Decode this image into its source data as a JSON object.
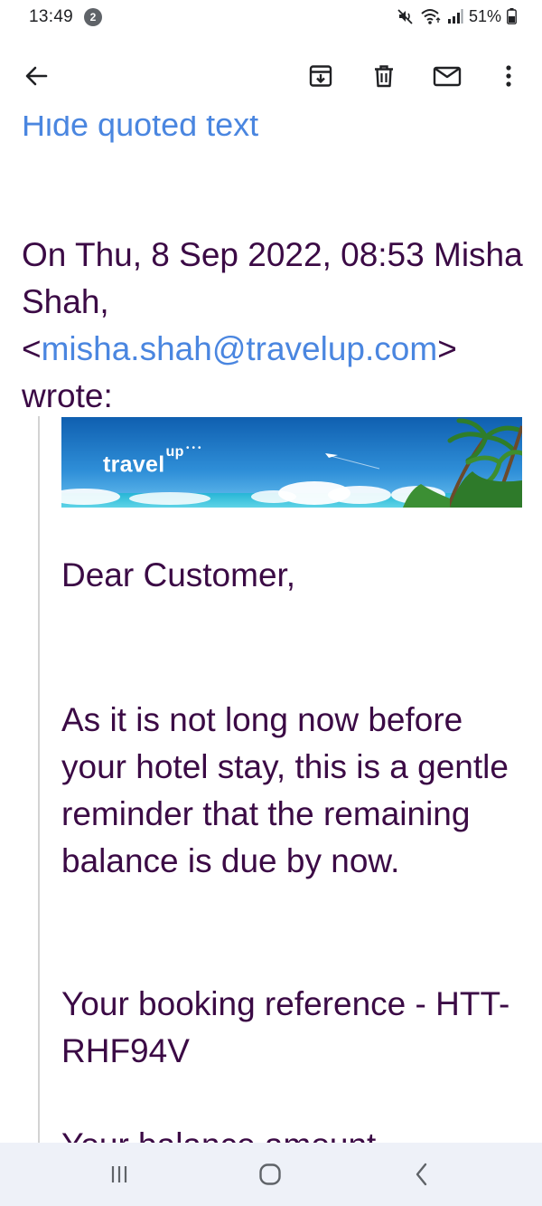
{
  "status_bar": {
    "time": "13:49",
    "notification_count": "2",
    "battery": "51%"
  },
  "toolbar": {
    "icons": [
      "back-arrow-icon",
      "archive-icon",
      "delete-icon",
      "mark-unread-icon",
      "more-vert-icon"
    ]
  },
  "email": {
    "hide_quoted_text": "Hide quoted text",
    "quote_header_prefix": "On Thu, 8 Sep 2022, 08:53 Misha Shah, <",
    "sender_email": "misha.shah@travelup.com",
    "quote_header_suffix": "> wrote:",
    "banner_logo": "travel",
    "banner_logo_sup": "up",
    "greeting": "Dear Customer,",
    "body_paragraph": "As it is not long now before your hotel stay, this is a gentle reminder that the remaining balance is due by now.",
    "booking_reference": "Your booking reference - HTT-RHF94V",
    "balance_line": "Your balance amount"
  },
  "colors": {
    "text": "#3b0a45",
    "link": "#4a86e0",
    "nav_bar_bg": "#eef1f8"
  }
}
